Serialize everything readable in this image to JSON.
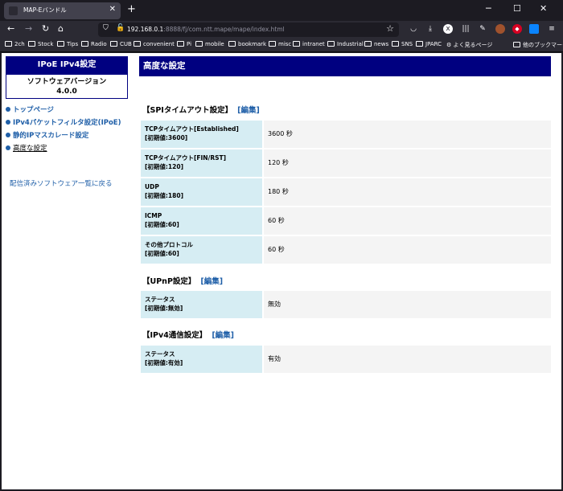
{
  "browser": {
    "tab_title": "MAP-Eバンドル",
    "url_host": "192.168.0.1",
    "url_rest": ":8888/fj/com.ntt.mape/mape/index.html",
    "bookmarks": [
      "2ch",
      "Stock",
      "Tips",
      "Radio",
      "CUB",
      "convenient",
      "Pi",
      "mobile",
      "bookmark",
      "misc",
      "intranet",
      "Industrial",
      "news",
      "SNS",
      "JPARC",
      "よく見るページ",
      "他のブックマーク"
    ]
  },
  "sidebar": {
    "heading": "IPoE IPv4設定",
    "version_label": "ソフトウェアバージョン",
    "version_value": "4.0.0",
    "nav": [
      {
        "label": "トップページ"
      },
      {
        "label": "IPv4パケットフィルタ設定(IPoE)"
      },
      {
        "label": "静的IPマスカレード設定"
      },
      {
        "label": "高度な設定"
      }
    ],
    "back_link": "配信済みソフトウェア一覧に戻る"
  },
  "main": {
    "title": "高度な設定",
    "sections": [
      {
        "title": "【SPIタイムアウト設定】",
        "edit": "[編集]",
        "rows": [
          {
            "name": "TCPタイムアウト[Established]",
            "default": "[初期値:3600]",
            "value": "3600 秒"
          },
          {
            "name": "TCPタイムアウト[FIN/RST]",
            "default": "[初期値:120]",
            "value": "120 秒"
          },
          {
            "name": "UDP",
            "default": "[初期値:180]",
            "value": "180 秒"
          },
          {
            "name": "ICMP",
            "default": "[初期値:60]",
            "value": "60 秒"
          },
          {
            "name": "その他プロトコル",
            "default": "[初期値:60]",
            "value": "60 秒"
          }
        ]
      },
      {
        "title": "【UPnP設定】",
        "edit": "[編集]",
        "rows": [
          {
            "name": "ステータス",
            "default": "[初期値:無効]",
            "value": "無効"
          }
        ]
      },
      {
        "title": "【IPv4通信設定】",
        "edit": "[編集]",
        "rows": [
          {
            "name": "ステータス",
            "default": "[初期値:有効]",
            "value": "有効"
          }
        ]
      }
    ]
  }
}
